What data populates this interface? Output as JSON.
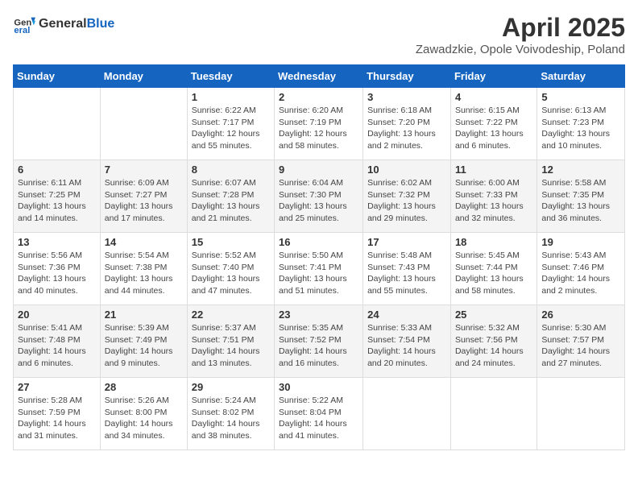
{
  "header": {
    "logo_general": "General",
    "logo_blue": "Blue",
    "month": "April 2025",
    "location": "Zawadzkie, Opole Voivodeship, Poland"
  },
  "days_of_week": [
    "Sunday",
    "Monday",
    "Tuesday",
    "Wednesday",
    "Thursday",
    "Friday",
    "Saturday"
  ],
  "weeks": [
    [
      {
        "day": "",
        "info": ""
      },
      {
        "day": "",
        "info": ""
      },
      {
        "day": "1",
        "info": "Sunrise: 6:22 AM\nSunset: 7:17 PM\nDaylight: 12 hours and 55 minutes."
      },
      {
        "day": "2",
        "info": "Sunrise: 6:20 AM\nSunset: 7:19 PM\nDaylight: 12 hours and 58 minutes."
      },
      {
        "day": "3",
        "info": "Sunrise: 6:18 AM\nSunset: 7:20 PM\nDaylight: 13 hours and 2 minutes."
      },
      {
        "day": "4",
        "info": "Sunrise: 6:15 AM\nSunset: 7:22 PM\nDaylight: 13 hours and 6 minutes."
      },
      {
        "day": "5",
        "info": "Sunrise: 6:13 AM\nSunset: 7:23 PM\nDaylight: 13 hours and 10 minutes."
      }
    ],
    [
      {
        "day": "6",
        "info": "Sunrise: 6:11 AM\nSunset: 7:25 PM\nDaylight: 13 hours and 14 minutes."
      },
      {
        "day": "7",
        "info": "Sunrise: 6:09 AM\nSunset: 7:27 PM\nDaylight: 13 hours and 17 minutes."
      },
      {
        "day": "8",
        "info": "Sunrise: 6:07 AM\nSunset: 7:28 PM\nDaylight: 13 hours and 21 minutes."
      },
      {
        "day": "9",
        "info": "Sunrise: 6:04 AM\nSunset: 7:30 PM\nDaylight: 13 hours and 25 minutes."
      },
      {
        "day": "10",
        "info": "Sunrise: 6:02 AM\nSunset: 7:32 PM\nDaylight: 13 hours and 29 minutes."
      },
      {
        "day": "11",
        "info": "Sunrise: 6:00 AM\nSunset: 7:33 PM\nDaylight: 13 hours and 32 minutes."
      },
      {
        "day": "12",
        "info": "Sunrise: 5:58 AM\nSunset: 7:35 PM\nDaylight: 13 hours and 36 minutes."
      }
    ],
    [
      {
        "day": "13",
        "info": "Sunrise: 5:56 AM\nSunset: 7:36 PM\nDaylight: 13 hours and 40 minutes."
      },
      {
        "day": "14",
        "info": "Sunrise: 5:54 AM\nSunset: 7:38 PM\nDaylight: 13 hours and 44 minutes."
      },
      {
        "day": "15",
        "info": "Sunrise: 5:52 AM\nSunset: 7:40 PM\nDaylight: 13 hours and 47 minutes."
      },
      {
        "day": "16",
        "info": "Sunrise: 5:50 AM\nSunset: 7:41 PM\nDaylight: 13 hours and 51 minutes."
      },
      {
        "day": "17",
        "info": "Sunrise: 5:48 AM\nSunset: 7:43 PM\nDaylight: 13 hours and 55 minutes."
      },
      {
        "day": "18",
        "info": "Sunrise: 5:45 AM\nSunset: 7:44 PM\nDaylight: 13 hours and 58 minutes."
      },
      {
        "day": "19",
        "info": "Sunrise: 5:43 AM\nSunset: 7:46 PM\nDaylight: 14 hours and 2 minutes."
      }
    ],
    [
      {
        "day": "20",
        "info": "Sunrise: 5:41 AM\nSunset: 7:48 PM\nDaylight: 14 hours and 6 minutes."
      },
      {
        "day": "21",
        "info": "Sunrise: 5:39 AM\nSunset: 7:49 PM\nDaylight: 14 hours and 9 minutes."
      },
      {
        "day": "22",
        "info": "Sunrise: 5:37 AM\nSunset: 7:51 PM\nDaylight: 14 hours and 13 minutes."
      },
      {
        "day": "23",
        "info": "Sunrise: 5:35 AM\nSunset: 7:52 PM\nDaylight: 14 hours and 16 minutes."
      },
      {
        "day": "24",
        "info": "Sunrise: 5:33 AM\nSunset: 7:54 PM\nDaylight: 14 hours and 20 minutes."
      },
      {
        "day": "25",
        "info": "Sunrise: 5:32 AM\nSunset: 7:56 PM\nDaylight: 14 hours and 24 minutes."
      },
      {
        "day": "26",
        "info": "Sunrise: 5:30 AM\nSunset: 7:57 PM\nDaylight: 14 hours and 27 minutes."
      }
    ],
    [
      {
        "day": "27",
        "info": "Sunrise: 5:28 AM\nSunset: 7:59 PM\nDaylight: 14 hours and 31 minutes."
      },
      {
        "day": "28",
        "info": "Sunrise: 5:26 AM\nSunset: 8:00 PM\nDaylight: 14 hours and 34 minutes."
      },
      {
        "day": "29",
        "info": "Sunrise: 5:24 AM\nSunset: 8:02 PM\nDaylight: 14 hours and 38 minutes."
      },
      {
        "day": "30",
        "info": "Sunrise: 5:22 AM\nSunset: 8:04 PM\nDaylight: 14 hours and 41 minutes."
      },
      {
        "day": "",
        "info": ""
      },
      {
        "day": "",
        "info": ""
      },
      {
        "day": "",
        "info": ""
      }
    ]
  ]
}
